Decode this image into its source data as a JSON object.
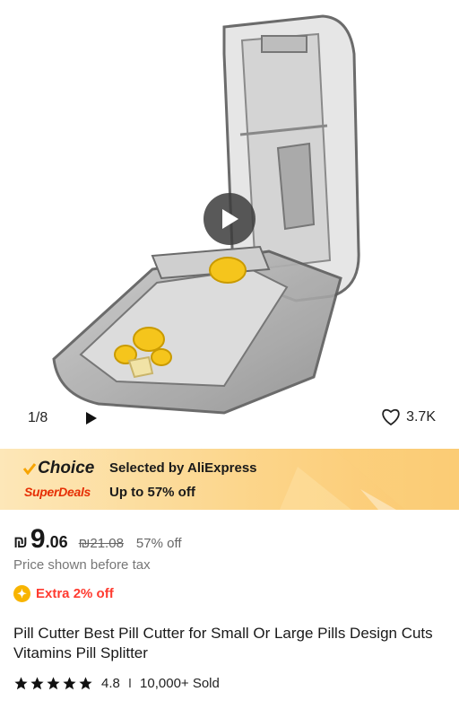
{
  "gallery": {
    "counter": "1/8",
    "likes": "3.7K",
    "icons": [
      "play-icon",
      "heart-icon"
    ]
  },
  "banner": {
    "choice_label": "Choice",
    "superdeals_label": "SuperDeals",
    "selected_text": "Selected by AliExpress",
    "discount_text": "Up to 57% off",
    "colors": {
      "choice_check": "#f7a400",
      "superdeals": "#e62e04"
    }
  },
  "price": {
    "currency": "₪",
    "integer": "9",
    "decimal": ".06",
    "original": "₪21.08",
    "discount": "57% off"
  },
  "tax_note": "Price shown before tax",
  "extra_offer": "Extra 2% off",
  "product": {
    "title": "Pill Cutter Best Pill Cutter for Small Or Large Pills Design Cuts Vitamins Pill Splitter",
    "rating": "4.8",
    "sold": "10,000+ Sold",
    "stars": 5
  }
}
